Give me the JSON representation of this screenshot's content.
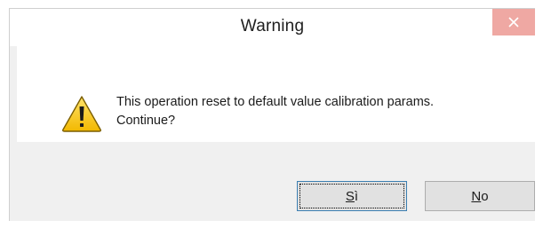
{
  "dialog": {
    "title": "Warning",
    "close_icon": "close-icon",
    "warning_icon": "warning-icon",
    "message": "This operation reset to default value calibration params.\nContinue?",
    "buttons": {
      "yes": {
        "mnemonic": "S",
        "rest": "ì"
      },
      "no": {
        "mnemonic": "N",
        "rest": "o"
      }
    }
  },
  "colors": {
    "close_button_bg": "#efa8a3",
    "footer_bg": "#f0f0f0",
    "default_button_border": "#3c7fb1",
    "warning_yellow": "#f5c400"
  }
}
